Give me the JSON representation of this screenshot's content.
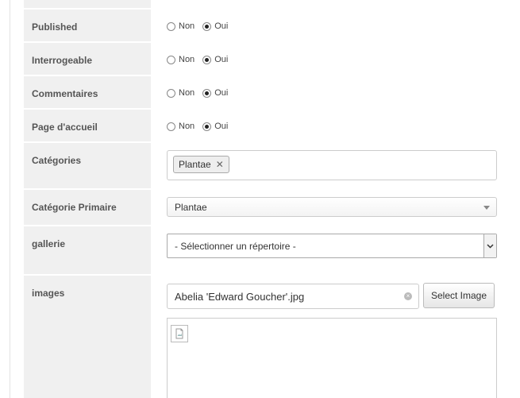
{
  "rows": {
    "published": {
      "label": "Published",
      "options": [
        "Non",
        "Oui"
      ],
      "selected": "Oui"
    },
    "interrogeable": {
      "label": "Interrogeable",
      "options": [
        "Non",
        "Oui"
      ],
      "selected": "Oui"
    },
    "commentaires": {
      "label": "Commentaires",
      "options": [
        "Non",
        "Oui"
      ],
      "selected": "Oui"
    },
    "page_accueil": {
      "label": "Page d'accueil",
      "options": [
        "Non",
        "Oui"
      ],
      "selected": "Oui"
    }
  },
  "categories": {
    "label": "Catégories",
    "tags": [
      "Plantae"
    ],
    "remove_glyph": "✕"
  },
  "primary_category": {
    "label": "Catégorie Primaire",
    "value": "Plantae"
  },
  "gallery": {
    "label": "gallerie",
    "value": "- Sélectionner un répertoire -"
  },
  "images": {
    "label": "images",
    "value": "Abelia 'Edward Goucher'.jpg",
    "select_button": "Select Image",
    "clear_glyph": "×"
  },
  "colors": {
    "label_bg": "#f0f0f0",
    "border": "#cccccc"
  }
}
